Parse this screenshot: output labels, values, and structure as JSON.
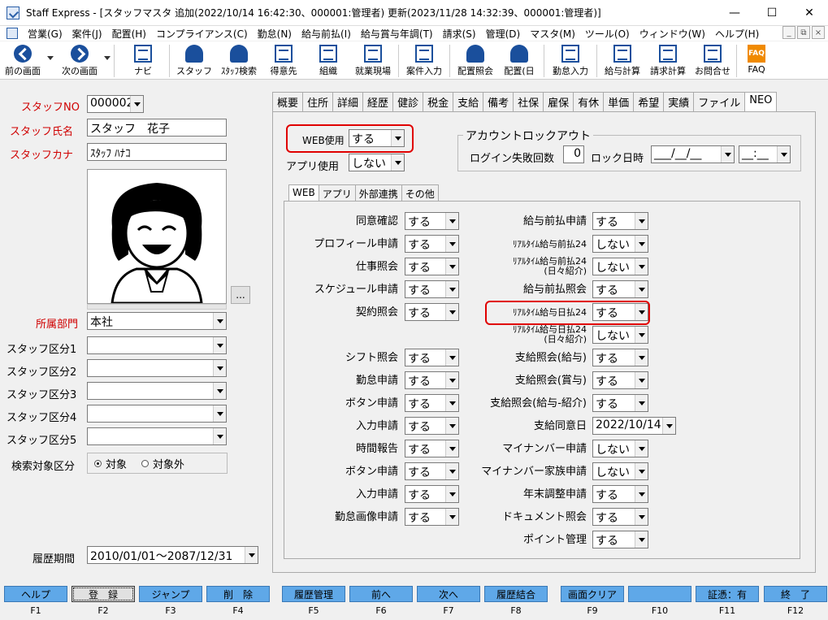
{
  "window": {
    "title": "Staff Express - [スタッフマスタ 追加(2022/10/14 16:42:30、000001:管理者) 更新(2023/11/28 14:32:39、000001:管理者)]",
    "minimize": "—",
    "maximize": "☐",
    "close": "✕"
  },
  "menu": [
    "営業(G)",
    "案件(J)",
    "配置(H)",
    "コンプライアンス(C)",
    "勤怠(N)",
    "給与前払(I)",
    "給与賞与年調(T)",
    "請求(S)",
    "管理(D)",
    "マスタ(M)",
    "ツール(O)",
    "ウィンドウ(W)",
    "ヘルプ(H)"
  ],
  "mdi": {
    "min": "_",
    "restore": "⧉",
    "close": "×"
  },
  "toolbar": {
    "back": "前の画面",
    "forward": "次の画面",
    "navi": "ナビ",
    "staff": "スタッフ",
    "staff_search": "ｽﾀｯﾌ検索",
    "client": "得意先",
    "org": "組織",
    "site": "就業現場",
    "case_entry": "案件入力",
    "placement_query": "配置照会",
    "placement_day": "配置(日",
    "attendance_entry": "勤怠入力",
    "payroll": "給与計算",
    "billing": "請求計算",
    "contact": "お問合せ",
    "faq": "FAQ",
    "faq_icon_text": "FAQ"
  },
  "left": {
    "staff_no_label": "スタッフNO",
    "staff_no_value": "000002",
    "staff_name_label": "スタッフ氏名",
    "staff_name_value": "スタッフ　花子",
    "staff_kana_label": "スタッフカナ",
    "staff_kana_value": "ｽﾀｯﾌ ﾊﾅｺ",
    "photo_button": "...",
    "dept_label": "所属部門",
    "dept_value": "本社",
    "cat1_label": "スタッフ区分1",
    "cat2_label": "スタッフ区分2",
    "cat3_label": "スタッフ区分3",
    "cat4_label": "スタッフ区分4",
    "cat5_label": "スタッフ区分5",
    "search_target_label": "検索対象区分",
    "search_target_on": "対象",
    "search_target_off": "対象外",
    "history_label": "履歴期間",
    "history_value": "2010/01/01～2087/12/31"
  },
  "tabs": [
    "概要",
    "住所",
    "詳細",
    "経歴",
    "健診",
    "税金",
    "支給",
    "備考",
    "社保",
    "雇保",
    "有休",
    "単価",
    "希望",
    "実績",
    "ファイル",
    "NEO"
  ],
  "neo": {
    "web_use_label": "WEB使用",
    "web_use_value": "する",
    "app_use_label": "アプリ使用",
    "app_use_value": "しない",
    "lockout_title": "アカウントロックアウト",
    "login_fail_label": "ログイン失敗回数",
    "login_fail_value": "0",
    "lock_datetime_label": "ロック日時",
    "lock_date_value": "___/__/__",
    "lock_time_value": "__:__"
  },
  "subtabs": [
    "WEB",
    "アプリ",
    "外部連携",
    "その他"
  ],
  "web_left": [
    {
      "label": "同意確認",
      "value": "する"
    },
    {
      "label": "プロフィール申請",
      "value": "する"
    },
    {
      "label": "仕事照会",
      "value": "する"
    },
    {
      "label": "スケジュール申請",
      "value": "する"
    },
    {
      "label": "契約照会",
      "value": "する"
    },
    {
      "label": "シフト照会",
      "value": "する"
    },
    {
      "label": "勤怠申請",
      "value": "する"
    },
    {
      "label": "ボタン申請",
      "value": "する"
    },
    {
      "label": "入力申請",
      "value": "する"
    },
    {
      "label": "時間報告",
      "value": "する"
    },
    {
      "label": "ボタン申請",
      "value": "する"
    },
    {
      "label": "入力申請",
      "value": "する"
    },
    {
      "label": "勤怠画像申請",
      "value": "する"
    }
  ],
  "web_right": [
    {
      "label": "給与前払申請",
      "value": "する"
    },
    {
      "label": "ﾘｱﾙﾀｲﾑ給与前払24",
      "value": "しない"
    },
    {
      "label": "ﾘｱﾙﾀｲﾑ給与前払24",
      "label2": "(日々紹介)",
      "value": "しない"
    },
    {
      "label": "給与前払照会",
      "value": "する"
    },
    {
      "label": "ﾘｱﾙﾀｲﾑ給与日払24",
      "value": "する"
    },
    {
      "label": "ﾘｱﾙﾀｲﾑ給与日払24",
      "label2": "(日々紹介)",
      "value": "しない"
    },
    {
      "label": "支給照会(給与)",
      "value": "する"
    },
    {
      "label": "支給照会(賞与)",
      "value": "する"
    },
    {
      "label": "支給照会(給与-紹介)",
      "value": "する"
    },
    {
      "label": "支給同意日",
      "value": "2022/10/14"
    },
    {
      "label": "マイナンバー申請",
      "value": "しない"
    },
    {
      "label": "マイナンバー家族申請",
      "value": "しない"
    },
    {
      "label": "年末調整申請",
      "value": "する"
    },
    {
      "label": "ドキュメント照会",
      "value": "する"
    },
    {
      "label": "ポイント管理",
      "value": "する"
    }
  ],
  "fkeys": [
    {
      "label": "ヘルプ",
      "key": "F1"
    },
    {
      "label": "登　録",
      "key": "F2"
    },
    {
      "label": "ジャンプ",
      "key": "F3"
    },
    {
      "label": "削　除",
      "key": "F4"
    },
    {
      "label": "履歴管理",
      "key": "F5"
    },
    {
      "label": "前へ",
      "key": "F6"
    },
    {
      "label": "次へ",
      "key": "F7"
    },
    {
      "label": "履歴結合",
      "key": "F8"
    },
    {
      "label": "画面クリア",
      "key": "F9"
    },
    {
      "label": "",
      "key": "F10"
    },
    {
      "label": "証憑：有",
      "key": "F11"
    },
    {
      "label": "終　了",
      "key": "F12"
    }
  ],
  "colors": {
    "accent": "#1a4f9c",
    "fkey": "#5fa8e8",
    "highlight": "#e00000",
    "required_label": "#d00000"
  }
}
